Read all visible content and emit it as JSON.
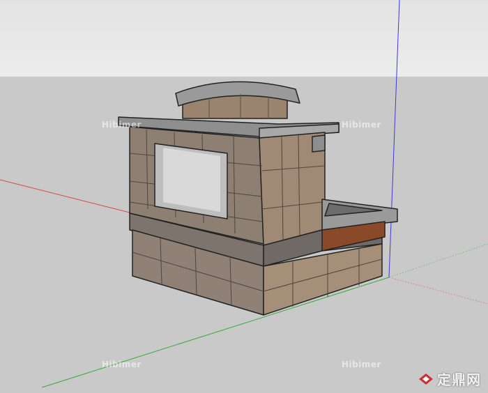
{
  "viewport": {
    "sky_color": "#e6e6e6",
    "ground_color": "#c9c9c9",
    "axes": {
      "red_axis_color": "#d24a4a",
      "green_axis_color": "#3aa83a",
      "blue_axis_color": "#3a3ad8"
    }
  },
  "model": {
    "object": "stone fireplace",
    "stone_colors": [
      "#8d7f72",
      "#a08a76",
      "#7d756d",
      "#9a8470",
      "#6f6a66",
      "#b49a80"
    ],
    "cap_color": "#8e8e8e",
    "screen_color": "#bdbdbd"
  },
  "watermarks": {
    "top_left": "Hibimer",
    "top_right": "Hibimer",
    "bottom_left": "Hibimer",
    "bottom_right": "Hibimer"
  },
  "logo": {
    "icon": "zhulong-diamond-icon",
    "text": "定鼎网",
    "icon_color": "#c83232"
  }
}
